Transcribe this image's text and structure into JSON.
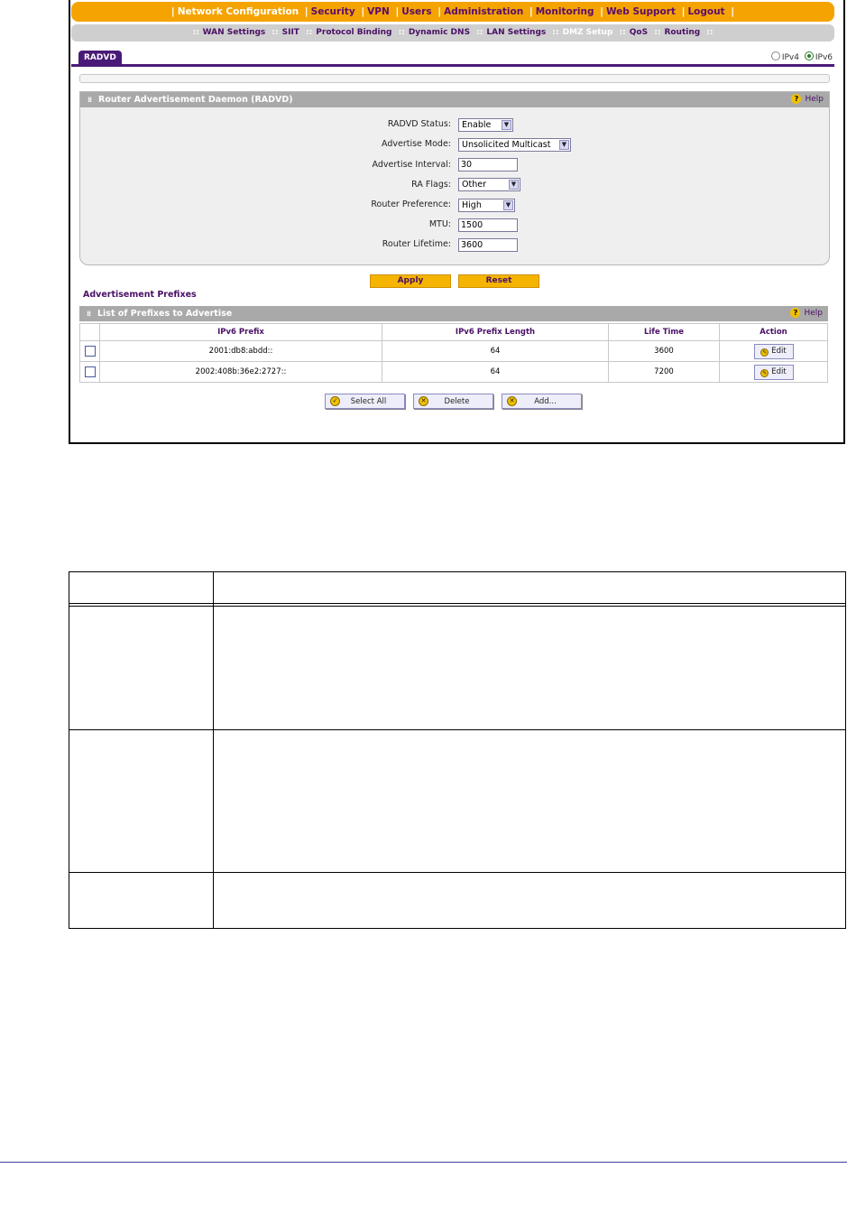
{
  "top_nav": {
    "items": [
      "Network Configuration",
      "Security",
      "VPN",
      "Users",
      "Administration",
      "Monitoring",
      "Web Support",
      "Logout"
    ],
    "active": "Network Configuration"
  },
  "sub_nav": {
    "items": [
      "WAN Settings",
      "SIIT",
      "Protocol Binding",
      "Dynamic DNS",
      "LAN Settings",
      "DMZ Setup",
      "QoS",
      "Routing"
    ]
  },
  "tab": {
    "label": "RADVD"
  },
  "ip_version": {
    "ipv4_label": "IPv4",
    "ipv6_label": "IPv6",
    "selected": "IPv6"
  },
  "radvd_section": {
    "title": "Router Advertisement Daemon (RADVD)",
    "help_label": "Help",
    "fields": {
      "status_label": "RADVD Status:",
      "status_value": "Enable",
      "mode_label": "Advertise Mode:",
      "mode_value": "Unsolicited Multicast",
      "interval_label": "Advertise Interval:",
      "interval_value": "30",
      "flags_label": "RA Flags:",
      "flags_value": "Other",
      "pref_label": "Router Preference:",
      "pref_value": "High",
      "mtu_label": "MTU:",
      "mtu_value": "1500",
      "lifetime_label": "Router Lifetime:",
      "lifetime_value": "3600"
    }
  },
  "buttons": {
    "apply": "Apply",
    "reset": "Reset",
    "select_all": "Select All",
    "delete": "Delete",
    "add": "Add...",
    "edit": "Edit"
  },
  "prefixes_section": {
    "heading": "Advertisement Prefixes",
    "title": "List of Prefixes to Advertise",
    "help_label": "Help",
    "columns": [
      "IPv6 Prefix",
      "IPv6 Prefix Length",
      "Life Time",
      "Action"
    ],
    "rows": [
      {
        "prefix": "2001:db8:abdd::",
        "length": "64",
        "lifetime": "3600"
      },
      {
        "prefix": "2002:408b:36e2:2727::",
        "length": "64",
        "lifetime": "7200"
      }
    ]
  },
  "colors": {
    "nav_orange": "#f5a300",
    "brand_purple": "#4a1a78",
    "button_yellow": "#f5b400",
    "header_gray": "#a9a9a9"
  }
}
